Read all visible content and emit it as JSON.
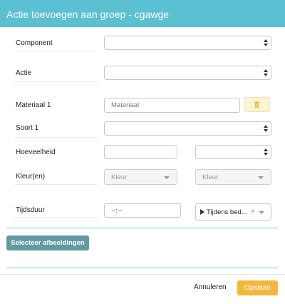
{
  "dialog": {
    "title": "Actie toevoegen aan groep - cgawge"
  },
  "form": {
    "component_label": "Component",
    "actie_label": "Actie",
    "materiaal_label": "Materiaal 1",
    "materiaal_placeholder": "Materiaal",
    "soort_label": "Soort 1",
    "hoeveelheid_label": "Hoeveelheid",
    "kleur_label": "Kleur(en)",
    "kleur_placeholder_1": "Kleur",
    "kleur_placeholder_2": "Kleur",
    "tijdsduur_label": "Tijdsduur",
    "tijd_value": "--:--",
    "tijdsduur_option": "Tijdens bed...",
    "clear_symbol": "×"
  },
  "buttons": {
    "select_images": "Selecteer afbeeldingen",
    "cancel": "Annuleren",
    "save": "Opslaan"
  },
  "icons": {
    "trash": "trash-icon",
    "play": "play-icon"
  },
  "colors": {
    "header": "#5bc0d1",
    "select_images_button": "#639aa1",
    "save_button": "#f6b53b",
    "trash_button": "#fcf2d6"
  }
}
